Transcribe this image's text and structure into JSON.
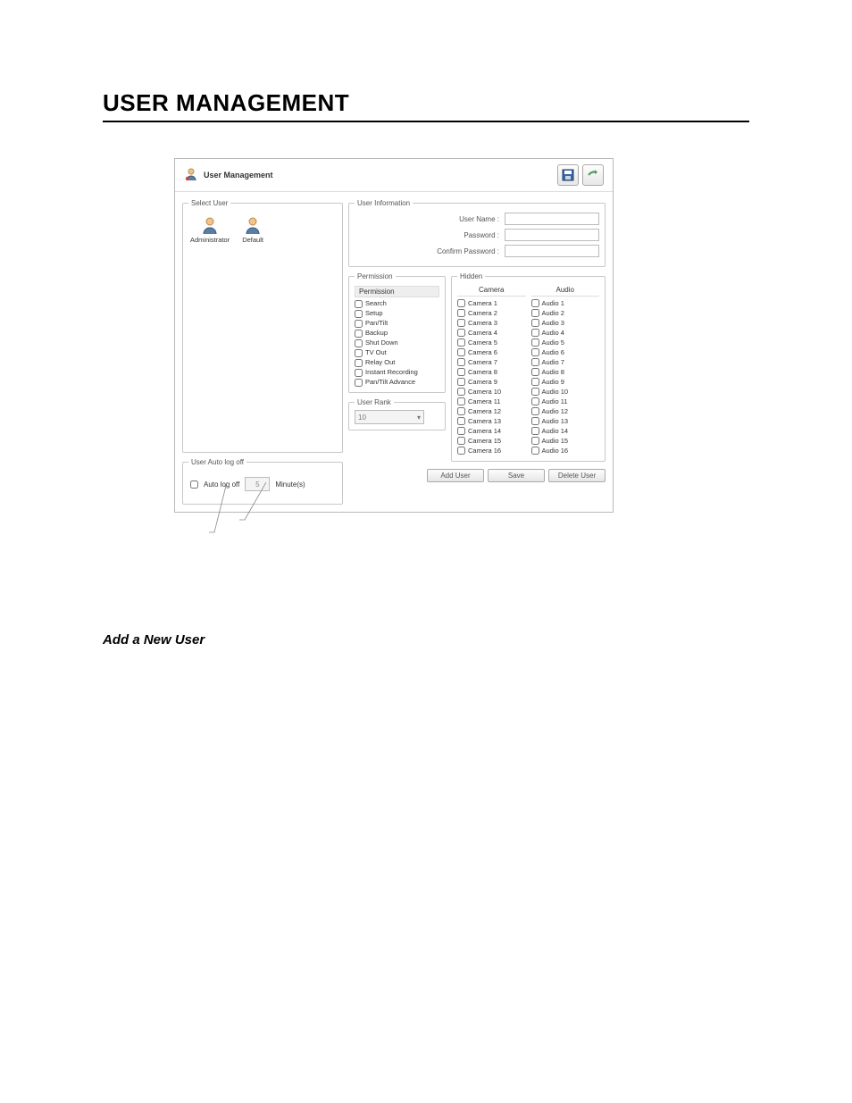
{
  "page": {
    "title": "USER MANAGEMENT",
    "section_heading": "Add a New User"
  },
  "dialog": {
    "title": "User Management"
  },
  "select_user": {
    "legend": "Select User",
    "users": [
      "Administrator",
      "Default"
    ]
  },
  "user_info": {
    "legend": "User Information",
    "labels": {
      "username": "User Name :",
      "password": "Password :",
      "confirm": "Confirm Password :"
    },
    "values": {
      "username": "",
      "password": "",
      "confirm": ""
    }
  },
  "permission": {
    "legend": "Permission",
    "header": "Permission",
    "items": [
      "Search",
      "Setup",
      "Pan/Tilt",
      "Backup",
      "Shut Down",
      "TV Out",
      "Relay Out",
      "Instant Recording",
      "Pan/Tilt Advance"
    ]
  },
  "hidden": {
    "legend": "Hidden",
    "camera_header": "Camera",
    "audio_header": "Audio",
    "cameras": [
      "Camera 1",
      "Camera 2",
      "Camera 3",
      "Camera 4",
      "Camera 5",
      "Camera 6",
      "Camera 7",
      "Camera 8",
      "Camera 9",
      "Camera 10",
      "Camera 11",
      "Camera 12",
      "Camera 13",
      "Camera 14",
      "Camera 15",
      "Camera 16"
    ],
    "audios": [
      "Audio 1",
      "Audio 2",
      "Audio 3",
      "Audio 4",
      "Audio 5",
      "Audio 6",
      "Audio 7",
      "Audio 8",
      "Audio 9",
      "Audio 10",
      "Audio 11",
      "Audio 12",
      "Audio 13",
      "Audio 14",
      "Audio 15",
      "Audio 16"
    ]
  },
  "user_rank": {
    "legend": "User Rank",
    "value": "10"
  },
  "auto_logoff": {
    "legend": "User Auto log off",
    "label": "Auto log off",
    "value": "5",
    "unit": "Minute(s)"
  },
  "buttons": {
    "add": "Add User",
    "save": "Save",
    "delete": "Delete User"
  }
}
